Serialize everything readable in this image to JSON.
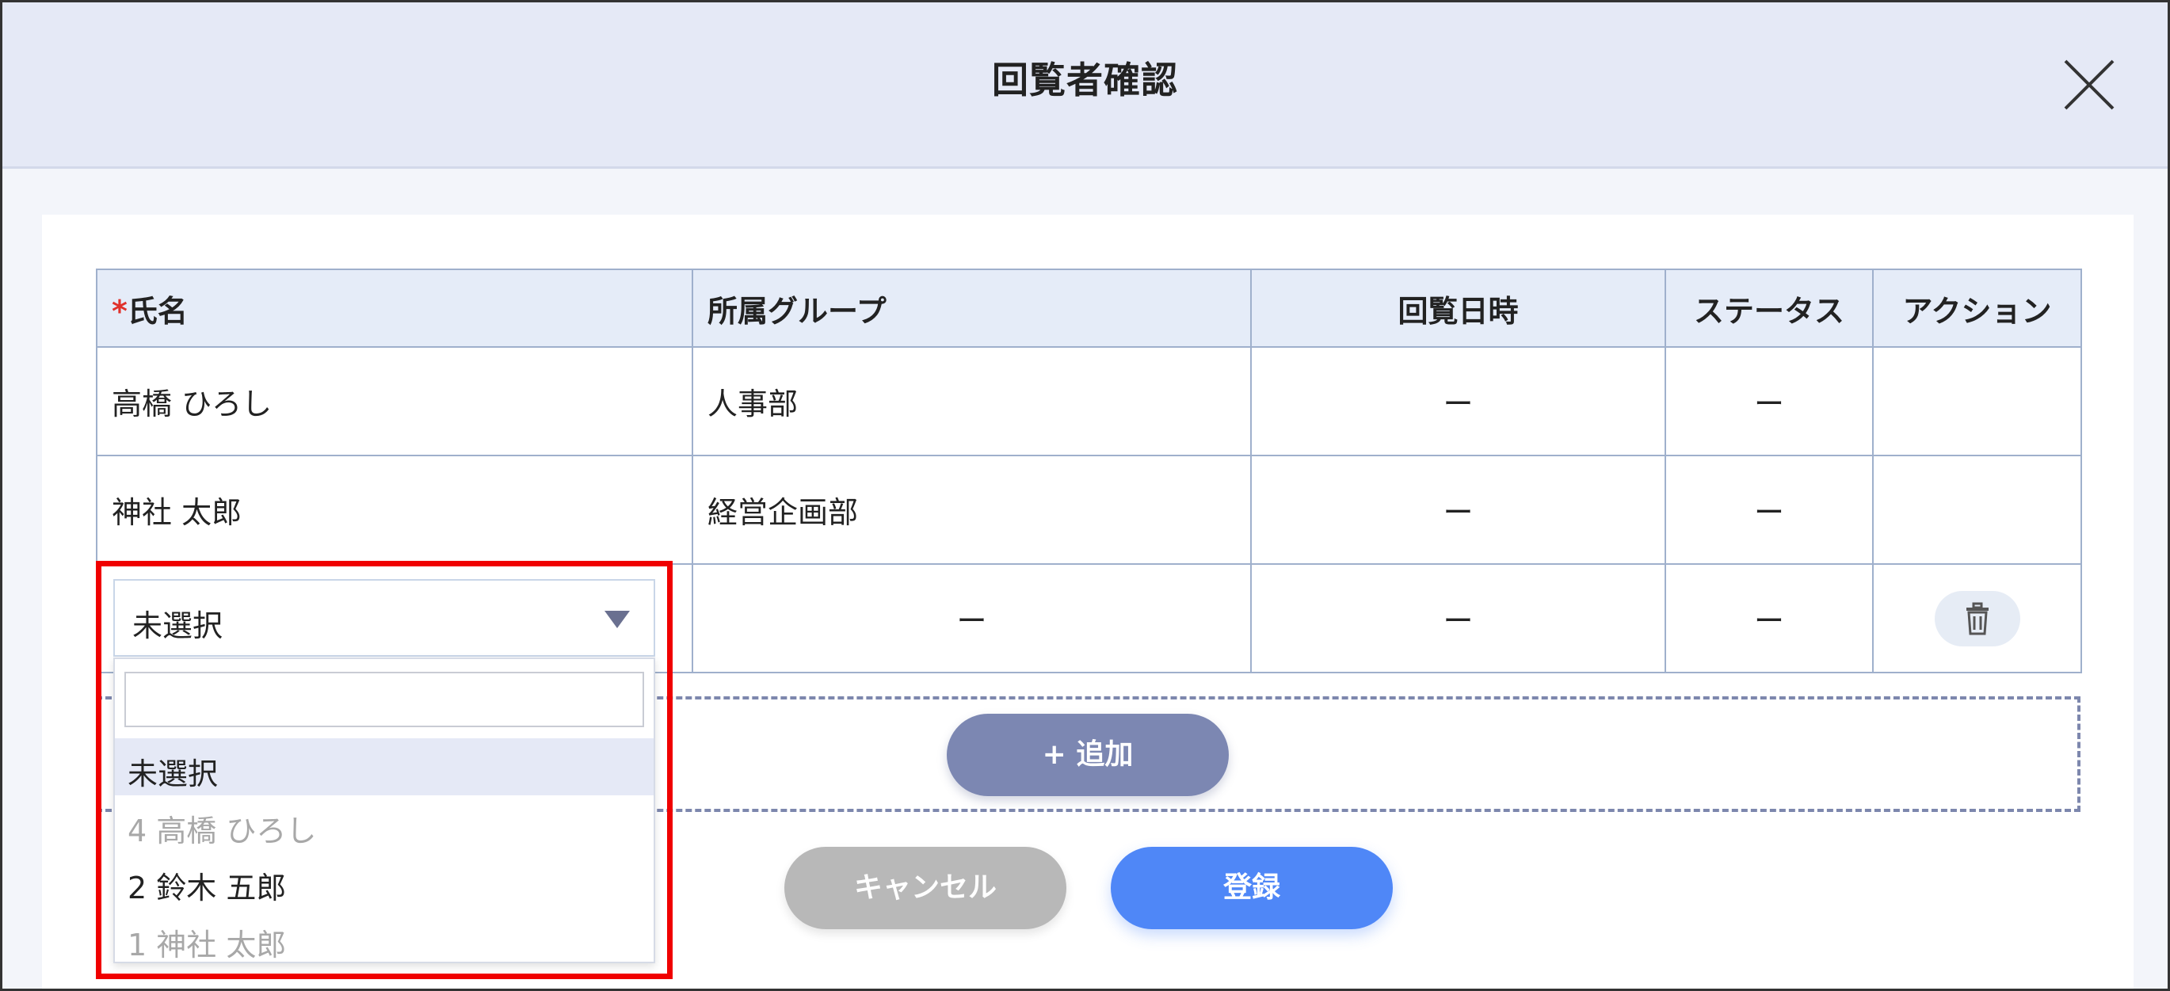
{
  "dialog": {
    "title": "回覧者確認"
  },
  "table": {
    "headers": {
      "required_mark": "*",
      "name": "氏名",
      "group": "所属グループ",
      "datetime": "回覧日時",
      "status": "ステータス",
      "action": "アクション"
    },
    "rows": [
      {
        "name": "高橋 ひろし",
        "group": "人事部",
        "datetime": "ー",
        "status": "ー"
      },
      {
        "name": "神社 太郎",
        "group": "経営企画部",
        "datetime": "ー",
        "status": "ー"
      }
    ],
    "new_row": {
      "group": "ー",
      "datetime": "ー",
      "status": "ー"
    }
  },
  "select": {
    "value": "未選択",
    "search_placeholder": "",
    "options": [
      {
        "label": "未選択",
        "state": "selected"
      },
      {
        "label": "4 高橋 ひろし",
        "state": "disabled"
      },
      {
        "label": "2 鈴木 五郎",
        "state": "normal"
      },
      {
        "label": "1 神社 太郎",
        "state": "disabled"
      }
    ]
  },
  "buttons": {
    "add": "+  追加",
    "cancel": "キャンセル",
    "register": "登録"
  },
  "colors": {
    "header_bg": "#e5e9f6",
    "accent_blue": "#4f87f7",
    "add_button": "#7c87b2",
    "cancel_button": "#b8b8b8",
    "required_red": "#e0312b",
    "highlight_red": "#f00000"
  },
  "icons": {
    "close": "close-icon",
    "dropdown_arrow": "triangle-down-icon",
    "delete": "trash-icon"
  }
}
